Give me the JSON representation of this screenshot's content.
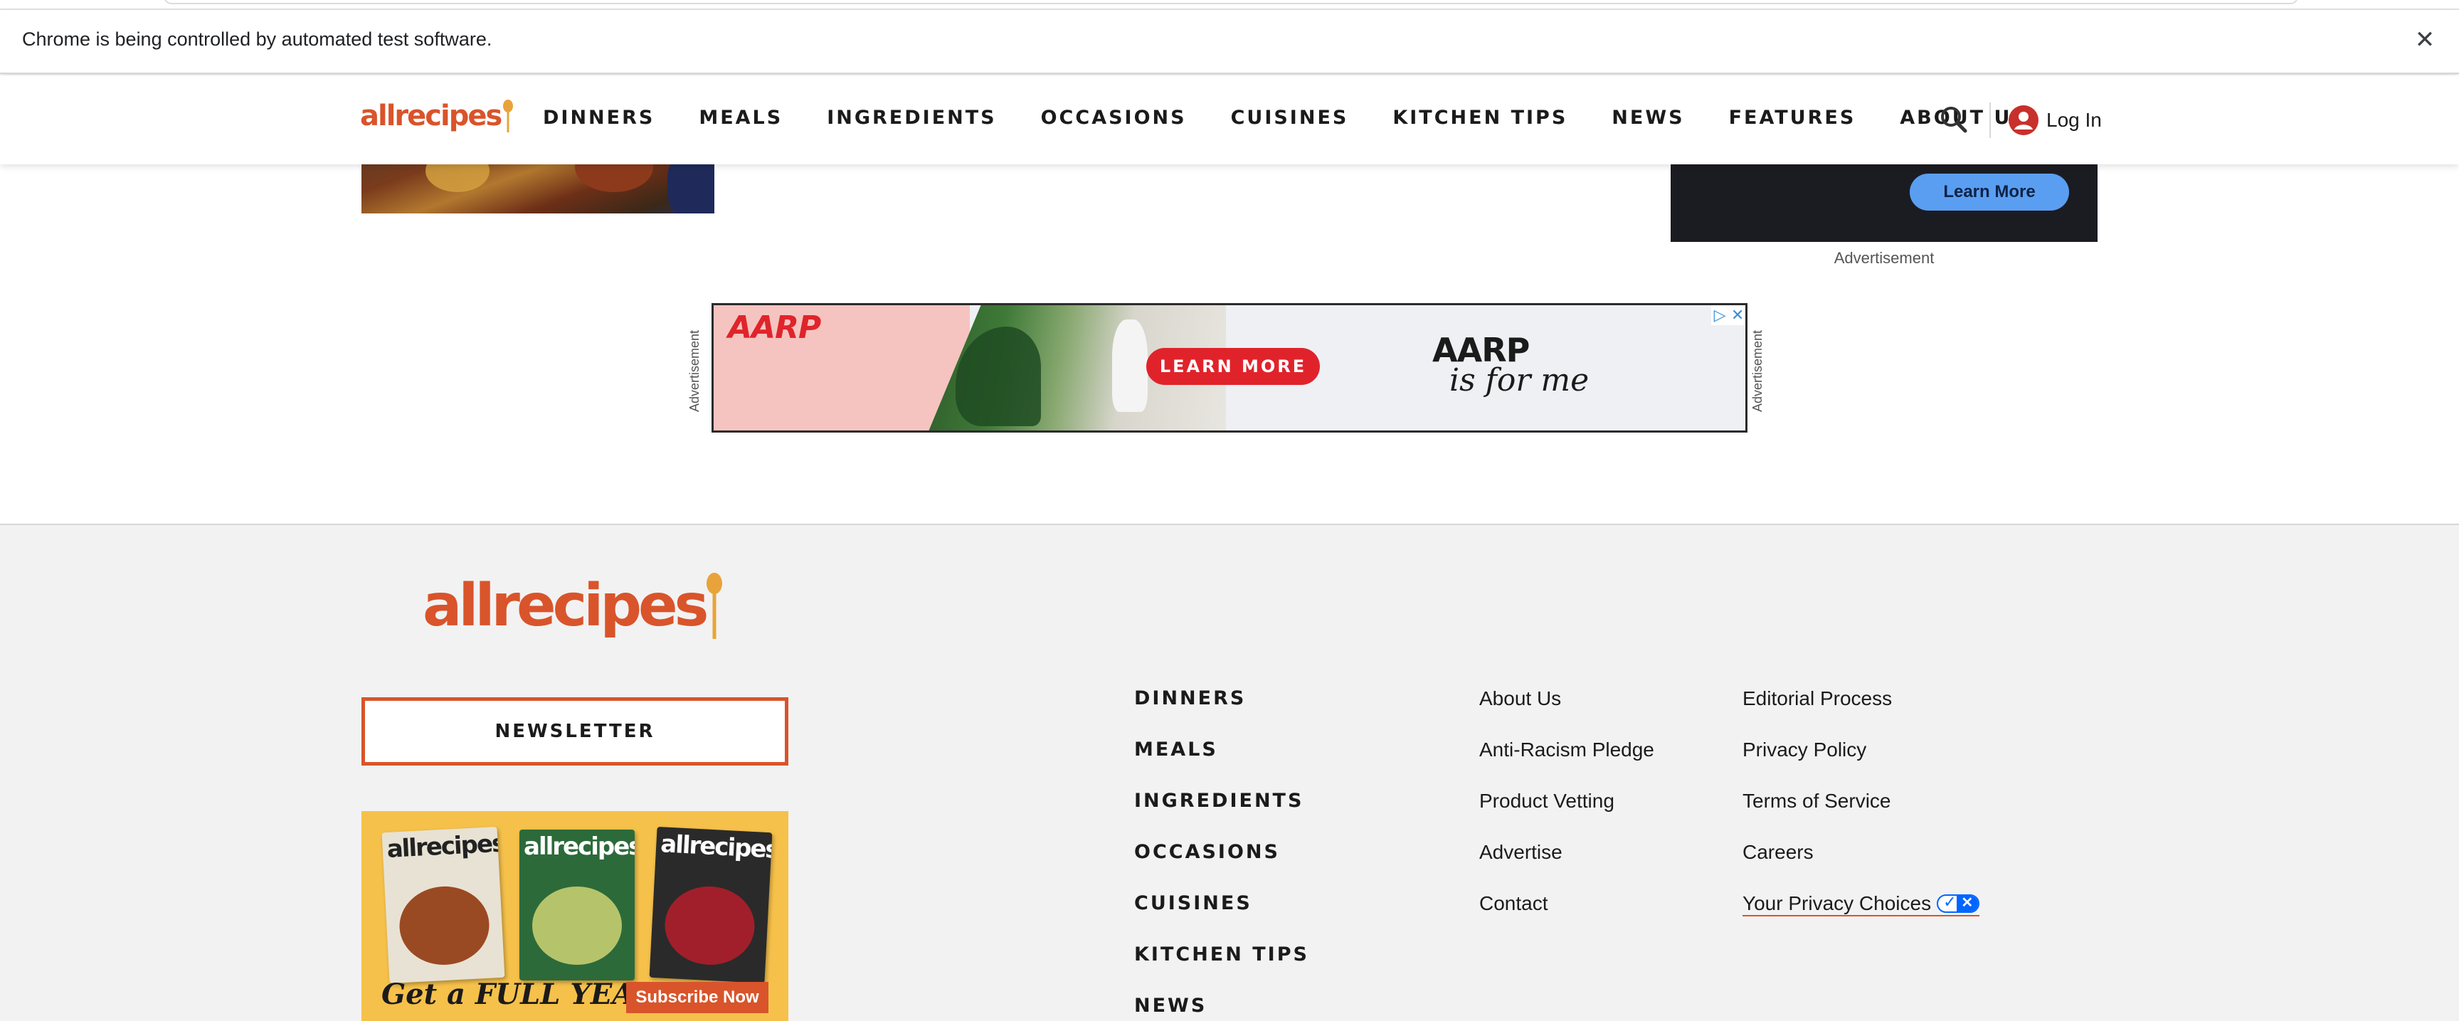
{
  "browser": {
    "infobar_text": "Chrome is being controlled by automated test software.",
    "close_glyph": "✕"
  },
  "header": {
    "logo_text": "allrecipes",
    "nav": [
      "DINNERS",
      "MEALS",
      "INGREDIENTS",
      "OCCASIONS",
      "CUISINES",
      "KITCHEN TIPS",
      "NEWS",
      "FEATURES",
      "ABOUT US"
    ],
    "search_icon": "search-icon",
    "login_label": "Log In",
    "login_icon": "user-account-icon"
  },
  "side_ad": {
    "button_label": "Learn More",
    "caption": "Advertisement"
  },
  "aarp_ad": {
    "side_label": "Advertisement",
    "logo_text": "AARP",
    "cta_label": "LEARN MORE",
    "brand_text": "AARP",
    "tagline": "is for me",
    "adchoices_icon": "adchoices-icon",
    "close_icon": "close-icon"
  },
  "footer": {
    "logo_text": "allrecipes",
    "newsletter_label": "NEWSLETTER",
    "magazine": {
      "cover_title": "allrecipes",
      "tagline": "Get a FULL YEAR!",
      "subscribe_label": "Subscribe Now"
    },
    "categories": [
      "DINNERS",
      "MEALS",
      "INGREDIENTS",
      "OCCASIONS",
      "CUISINES",
      "KITCHEN TIPS",
      "NEWS"
    ],
    "links_col1": [
      "About Us",
      "Anti-Racism Pledge",
      "Product Vetting",
      "Advertise",
      "Contact"
    ],
    "links_col2": [
      "Editorial Process",
      "Privacy Policy",
      "Terms of Service",
      "Careers",
      "Your Privacy Choices"
    ]
  },
  "colors": {
    "brand": "#d9542b",
    "text": "#1b1b1b",
    "footer_bg": "#f2f2f2",
    "aarp_red": "#e0232b",
    "privacy_blue": "#0066ff"
  }
}
